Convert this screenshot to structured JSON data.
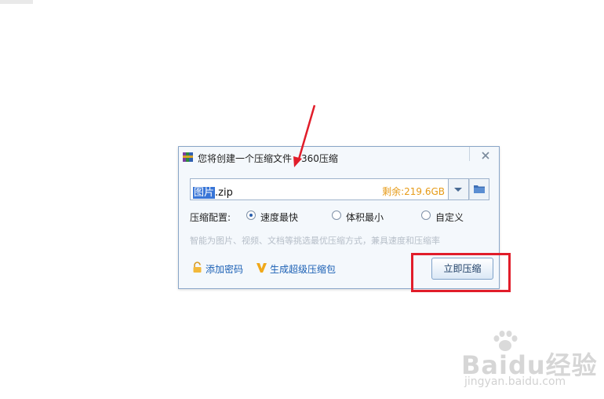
{
  "dialog": {
    "title": "您将创建一个压缩文件 - 360压缩",
    "filename_selected": "图片",
    "filename_rest": ".zip",
    "free_space": "剩余:219.6GB",
    "config_label": "压缩配置:",
    "options": [
      {
        "label": "速度最快",
        "checked": true
      },
      {
        "label": "体积最小",
        "checked": false
      },
      {
        "label": "自定义",
        "checked": false
      }
    ],
    "hint": "智能为图片、视频、文档等挑选最优压缩方式，兼具速度和压缩率",
    "add_password": "添加密码",
    "super_pack": "生成超级压缩包",
    "compress_button": "立即压缩"
  },
  "annotation": {
    "color": "#e11d2a"
  },
  "watermark": {
    "logo": "Baidu经验",
    "url": "jingyan.baidu.com"
  }
}
